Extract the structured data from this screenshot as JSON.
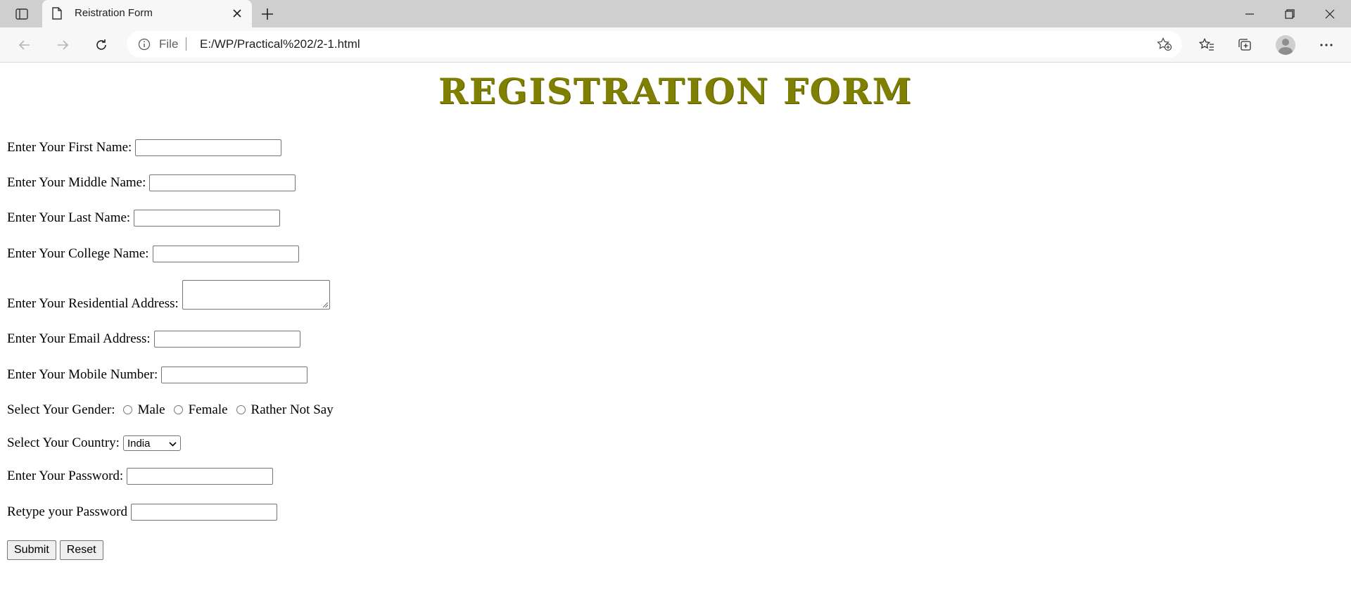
{
  "browser": {
    "tab_title": "Reistration Form",
    "scheme": "File",
    "url": "E:/WP/Practical%202/2-1.html"
  },
  "page": {
    "heading": "REGISTRATION FORM",
    "fields": {
      "first_name": "Enter Your First Name:",
      "middle_name": "Enter Your Middle Name:",
      "last_name": "Enter Your Last Name:",
      "college_name": "Enter Your College Name:",
      "address": "Enter Your Residential Address:",
      "email": "Enter Your Email Address:",
      "mobile": "Enter Your Mobile Number:",
      "password": "Enter Your Password:",
      "retype_password": "Retype your Password"
    },
    "gender": {
      "label": "Select Your Gender:",
      "options": [
        "Male",
        "Female",
        "Rather Not Say"
      ]
    },
    "country": {
      "label": "Select Your Country:",
      "selected": "India"
    },
    "buttons": {
      "submit": "Submit",
      "reset": "Reset"
    }
  },
  "colors": {
    "heading": "#808000",
    "tabstrip": "#cfcfcf",
    "toolbar": "#f7f7f7"
  }
}
